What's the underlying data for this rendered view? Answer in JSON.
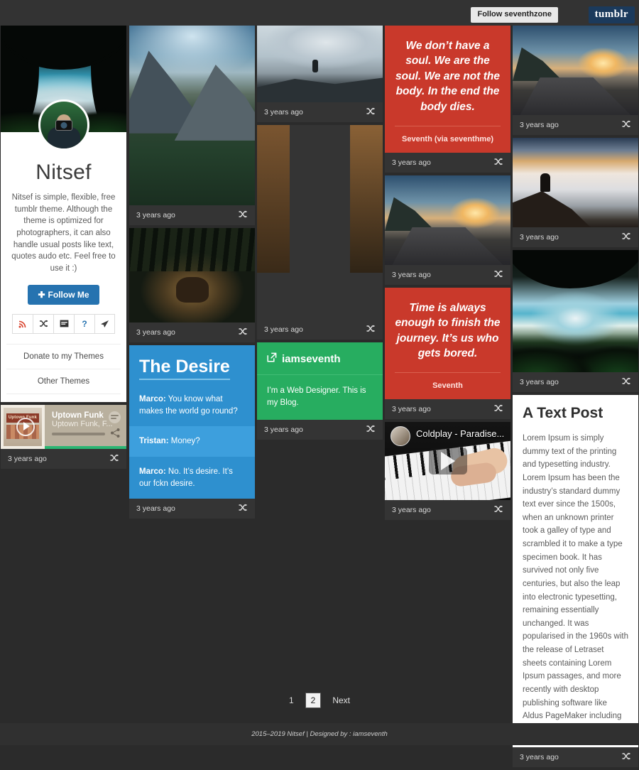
{
  "topbar": {
    "follow_label": "Follow seventhzone",
    "tumblr_label": "tumblr"
  },
  "sidebar": {
    "title": "Nitsef",
    "description": "Nitsef is simple, flexible, free tumblr theme. Although the theme is optimized for photographers, it can also handle usual posts like text, quotes audo etc. Feel free to use it :)",
    "follow_label": "Follow Me",
    "follow_plus": "✚",
    "icons": [
      {
        "name": "rss-icon",
        "glyph": "⋰"
      },
      {
        "name": "random-icon",
        "glyph": "⤫"
      },
      {
        "name": "archive-icon",
        "glyph": "▤"
      },
      {
        "name": "ask-icon",
        "glyph": "?"
      },
      {
        "name": "submit-icon",
        "glyph": "➤"
      }
    ],
    "links": [
      "Donate to my Themes",
      "Other Themes"
    ],
    "cover_alt": "coastal ocean view framed by dark trees",
    "avatar_alt": "person holding a camera"
  },
  "audio_post": {
    "art_label": "Uptown Funk",
    "track": "Uptown Funk",
    "subtitle": "Uptown Funk, F...",
    "date": "3 years ago"
  },
  "posts": {
    "quote1": {
      "text": "We don’t have a soul. We are the soul. We are not the body. In the end the body dies.",
      "source": "Seventh (via seventhme)",
      "date": "3 years ago",
      "color": "#c9392b"
    },
    "quote2": {
      "text": "Time is always enough to finish the journey. It’s us who gets bored.",
      "source": "Seventh",
      "date": "3 years ago",
      "color": "#c9392b"
    },
    "chat": {
      "title": "The Desire",
      "lines": [
        {
          "speaker": "Marco:",
          "text": " You know what makes the world go round?"
        },
        {
          "speaker": "Tristan:",
          "text": " Money?"
        },
        {
          "speaker": "Marco:",
          "text": " No. It’s desire. It’s our fckn desire."
        }
      ],
      "date": "3 years ago",
      "color": "#2e90cf"
    },
    "link": {
      "title": "iamseventh",
      "description": "I’m a Web Designer. This is my Blog.",
      "date": "3 years ago",
      "color": "#27ad60"
    },
    "video": {
      "title": "Coldplay - Paradise...",
      "date": "3 years ago"
    },
    "text": {
      "title": "A Text Post",
      "body": "Lorem Ipsum is simply dummy text of the printing and typesetting industry. Lorem Ipsum has been the industry’s standard dummy text ever since the 1500s, when an unknown printer took a galley of type and scrambled it to make a type specimen book. It has survived not only five centuries, but also the leap into electronic typesetting, remaining essentially unchanged. It was popularised in the 1960s with the release of Letraset sheets containing Lorem Ipsum passages, and more recently with desktop publishing software like Aldus PageMaker including versions of Lorem Ipsum.",
      "date": "3 years ago"
    },
    "photos": [
      {
        "id": "mountains",
        "alt": "hikers on an alpine mountain trail",
        "date": "3 years ago"
      },
      {
        "id": "bear",
        "alt": "bear in a dark forest",
        "date": "3 years ago"
      },
      {
        "id": "cliff",
        "alt": "person sitting on a cliff edge",
        "date": "3 years ago"
      },
      {
        "id": "alley",
        "alt": "golden lit cobblestone alley",
        "date": "3 years ago"
      },
      {
        "id": "sunsetroad",
        "alt": "mountain road at sunset",
        "date": "3 years ago"
      },
      {
        "id": "clouds",
        "alt": "person above a sea of clouds",
        "date": "3 years ago"
      },
      {
        "id": "ocean",
        "alt": "ocean cove framed by trees",
        "date": "3 years ago"
      }
    ]
  },
  "reblog_icon": "⤫",
  "pagination": {
    "pages": [
      "1",
      "2"
    ],
    "active": "2",
    "next_label": "Next"
  },
  "footer": {
    "text": "2015–2019 Nitsef | Designed by : iamseventh"
  }
}
